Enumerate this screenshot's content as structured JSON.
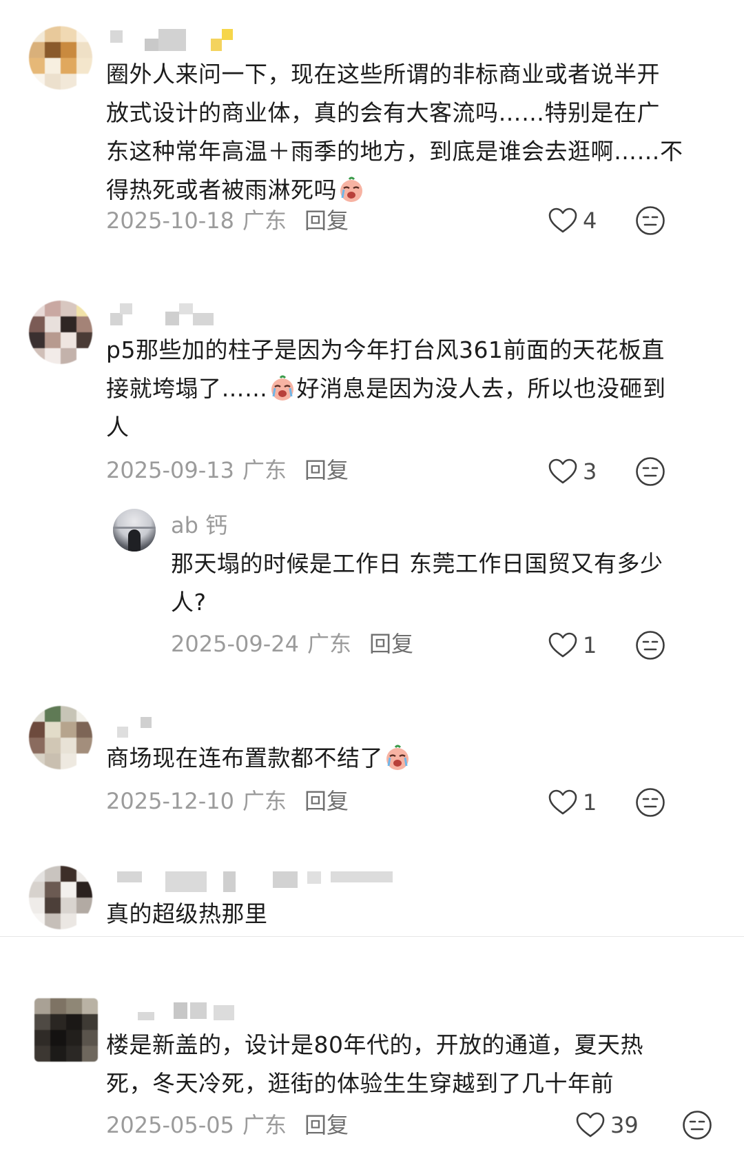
{
  "comments": [
    {
      "text_lines": [
        "圈外人来问一下，现在这些所谓的非标商业或者说半开",
        "放式设计的商业体，真的会有大客流吗……特别是在广",
        "东这种常年高温＋雨季的地方，到底是谁会去逛啊……不",
        "得热死或者被雨淋死吗"
      ],
      "date": "2025-10-18",
      "location": "广东",
      "reply_label": "回复",
      "likes": "4"
    },
    {
      "text_lines": [
        "p5那些加的柱子是因为今年打台风361前面的天花板直",
        "接就垮塌了……",
        "好消息是因为没人去，所以也没砸到",
        "人"
      ],
      "date": "2025-09-13",
      "location": "广东",
      "reply_label": "回复",
      "likes": "3"
    },
    {
      "text_lines": [
        "商场现在连布置款都不结了"
      ],
      "date": "2025-12-10",
      "location": "广东",
      "reply_label": "回复",
      "likes": "1"
    },
    {
      "text_lines": [
        "真的超级热那里"
      ]
    },
    {
      "text_lines": [
        "楼是新盖的，设计是80年代的，开放的通道，夏天热",
        "死，冬天冷死，逛街的体验生生穿越到了几十年前"
      ],
      "date": "2025-05-05",
      "location": "广东",
      "reply_label": "回复",
      "likes": "39"
    }
  ],
  "reply": {
    "author": "ab 钙",
    "text_lines": [
      "那天塌的时候是工作日 东莞工作日国贸又有多少",
      "人?"
    ],
    "date": "2025-09-24",
    "location": "广东",
    "reply_label": "回复",
    "likes": "1"
  },
  "icons": {
    "like": "heart-outline-icon",
    "dislike": "neutral-face-icon",
    "emoji": "crying-face-emoji"
  },
  "colors": {
    "text": "#1c1c1c",
    "meta": "#9b9b9b",
    "icon": "#4a4a4a"
  }
}
